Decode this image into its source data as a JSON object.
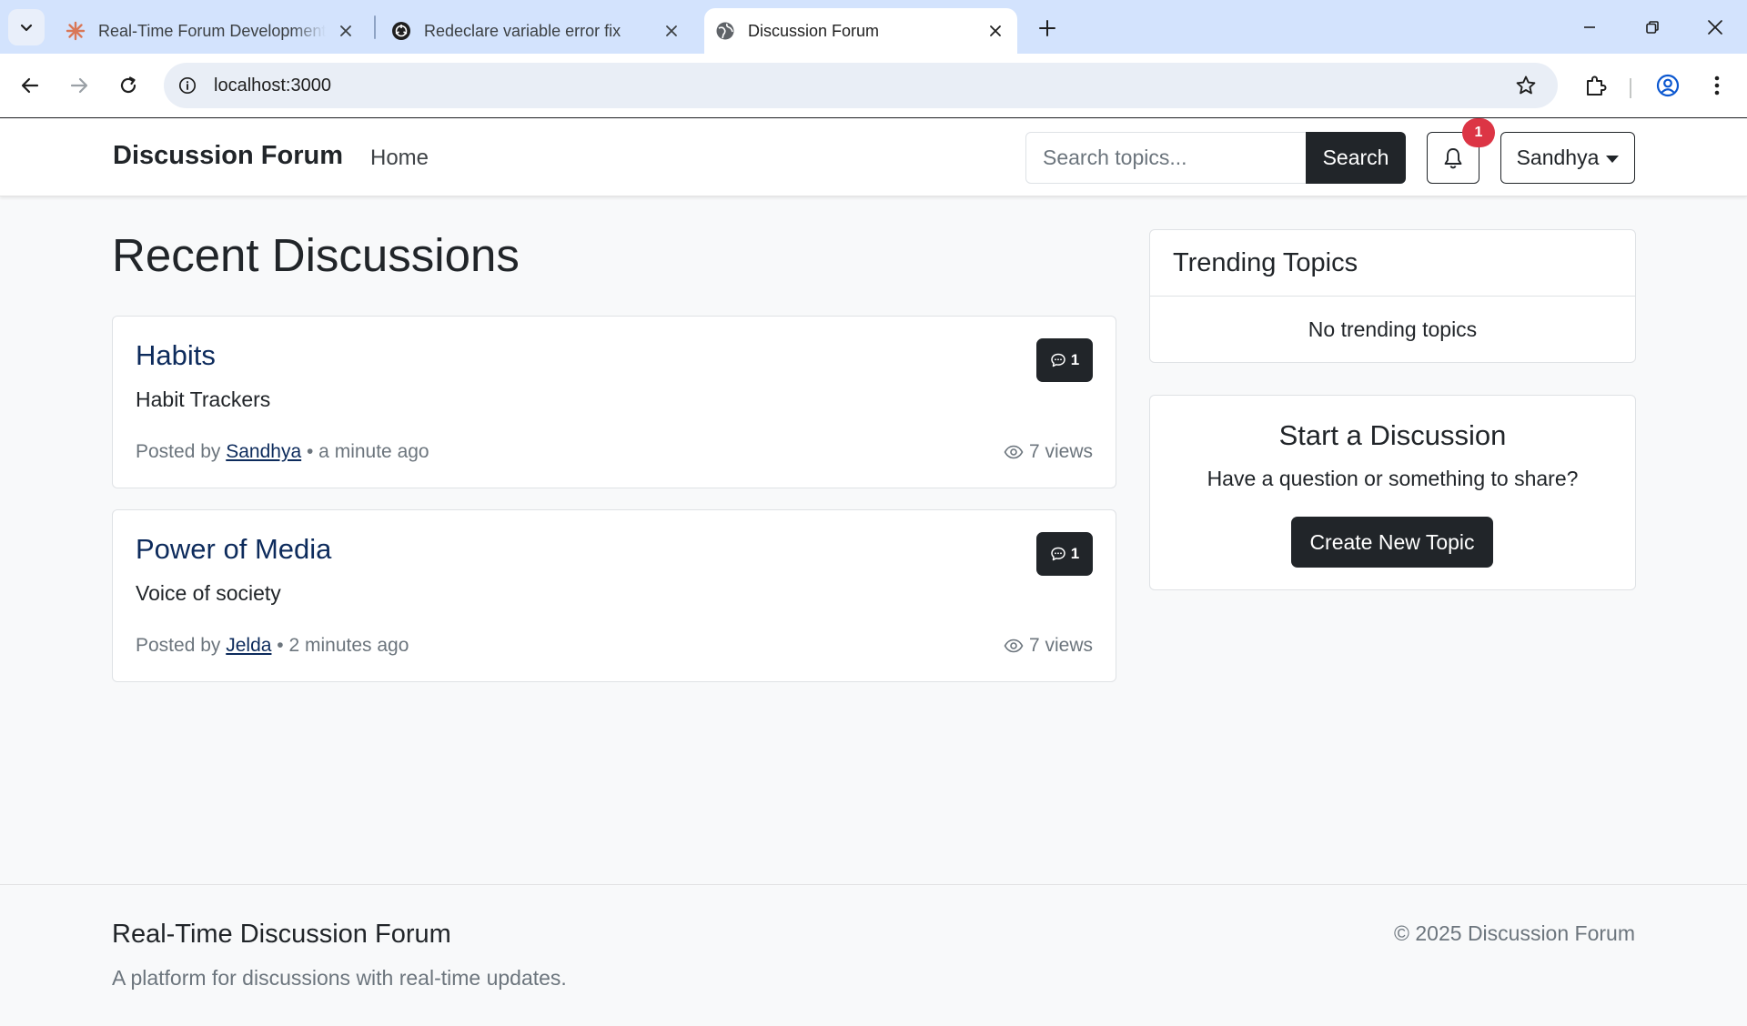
{
  "browser": {
    "tabs": [
      {
        "title": "Real-Time Forum Development",
        "icon": "claude-asterisk-icon"
      },
      {
        "title": "Redeclare variable error fix",
        "icon": "openai-logo-icon"
      },
      {
        "title": "Discussion Forum",
        "icon": "globe-icon",
        "active": true
      }
    ],
    "url": "localhost:3000"
  },
  "nav": {
    "brand": "Discussion Forum",
    "home": "Home",
    "search_placeholder": "Search topics...",
    "search_label": "Search",
    "notification_count": "1",
    "user": "Sandhya"
  },
  "main": {
    "title": "Recent Discussions",
    "topics": [
      {
        "title": "Habits",
        "description": "Habit Trackers",
        "posted_by": "Posted by",
        "author": "Sandhya",
        "time": "• a minute ago",
        "replies": "1",
        "views": "7 views"
      },
      {
        "title": "Power of Media",
        "description": "Voice of society",
        "posted_by": "Posted by",
        "author": "Jelda",
        "time": "• 2 minutes ago",
        "replies": "1",
        "views": "7 views"
      }
    ]
  },
  "sidebar": {
    "trending_title": "Trending Topics",
    "trending_empty": "No trending topics",
    "start_title": "Start a Discussion",
    "start_text": "Have a question or something to share?",
    "create_label": "Create New Topic"
  },
  "footer": {
    "title": "Real-Time Discussion Forum",
    "tagline": "A platform for discussions with real-time updates.",
    "copyright": "© 2025 Discussion Forum"
  },
  "colors": {
    "tabbar": "#d3e3fd",
    "dark": "#212529",
    "link": "#0d2b5c",
    "badge": "#dc3545",
    "muted": "#6c757d"
  }
}
